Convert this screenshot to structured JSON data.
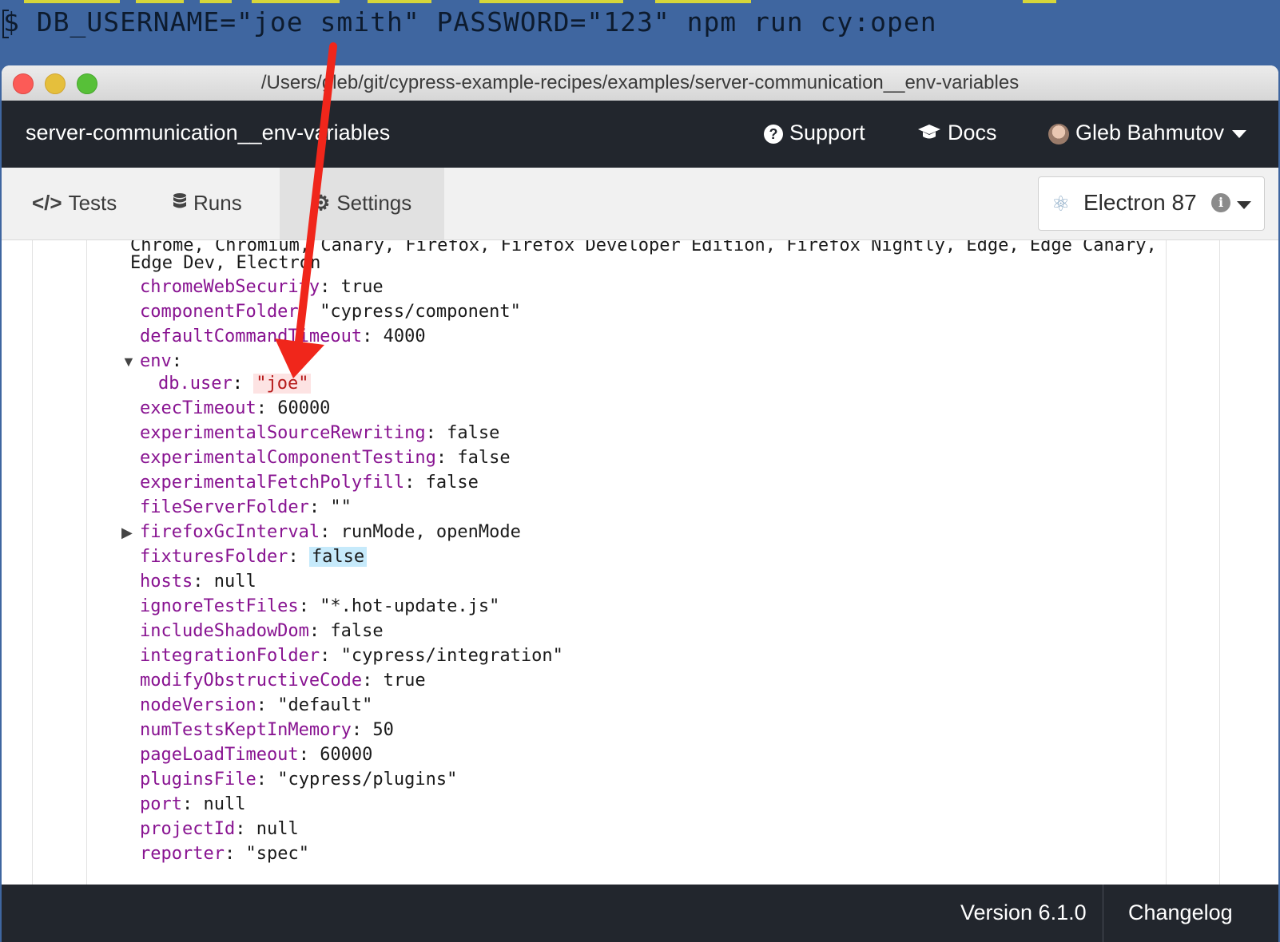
{
  "terminal": {
    "command": "$ DB_USERNAME=\"joe smith\" PASSWORD=\"123\" npm run cy:open"
  },
  "window": {
    "title": "/Users/gleb/git/cypress-example-recipes/examples/server-communication__env-variables"
  },
  "header": {
    "project_name": "server-communication__env-variables",
    "support_label": "Support",
    "docs_label": "Docs",
    "user_name": "Gleb Bahmutov"
  },
  "tabs": [
    {
      "label": "Tests",
      "icon": "code-icon"
    },
    {
      "label": "Runs",
      "icon": "database-icon"
    },
    {
      "label": "Settings",
      "icon": "gear-icon",
      "active": true
    }
  ],
  "browser_picker": {
    "label": "Electron 87"
  },
  "config": {
    "browsers_line1": "Chrome, Chromium, Canary, Firefox, Firefox Developer Edition, Firefox Nightly, Edge, Edge Canary,",
    "browsers_line2": "Edge Dev, Electron",
    "rows": [
      {
        "key": "chromeWebSecurity",
        "value": "true"
      },
      {
        "key": "componentFolder",
        "value": "\"cypress/component\""
      },
      {
        "key": "defaultCommandTimeout",
        "value": "4000"
      },
      {
        "key": "env",
        "value": ""
      },
      {
        "key": "db.user",
        "value": "\"joe\""
      },
      {
        "key": "execTimeout",
        "value": "60000"
      },
      {
        "key": "experimentalSourceRewriting",
        "value": "false"
      },
      {
        "key": "experimentalComponentTesting",
        "value": "false"
      },
      {
        "key": "experimentalFetchPolyfill",
        "value": "false"
      },
      {
        "key": "fileServerFolder",
        "value": "\"\""
      },
      {
        "key": "firefoxGcInterval",
        "value": "runMode, openMode"
      },
      {
        "key": "fixturesFolder",
        "value": "false"
      },
      {
        "key": "hosts",
        "value": "null"
      },
      {
        "key": "ignoreTestFiles",
        "value": "\"*.hot-update.js\""
      },
      {
        "key": "includeShadowDom",
        "value": "false"
      },
      {
        "key": "integrationFolder",
        "value": "\"cypress/integration\""
      },
      {
        "key": "modifyObstructiveCode",
        "value": "true"
      },
      {
        "key": "nodeVersion",
        "value": "\"default\""
      },
      {
        "key": "numTestsKeptInMemory",
        "value": "50"
      },
      {
        "key": "pageLoadTimeout",
        "value": "60000"
      },
      {
        "key": "pluginsFile",
        "value": "\"cypress/plugins\""
      },
      {
        "key": "port",
        "value": "null"
      },
      {
        "key": "projectId",
        "value": "null"
      },
      {
        "key": "reporter",
        "value": "\"spec\""
      }
    ]
  },
  "footer": {
    "version": "Version 6.1.0",
    "changelog": "Changelog"
  },
  "colors": {
    "terminal_bg": "#3f66a0",
    "header_bg": "#22262d",
    "key": "#881391",
    "env_highlight": "#fde3e3",
    "arrow": "#f0261b"
  }
}
